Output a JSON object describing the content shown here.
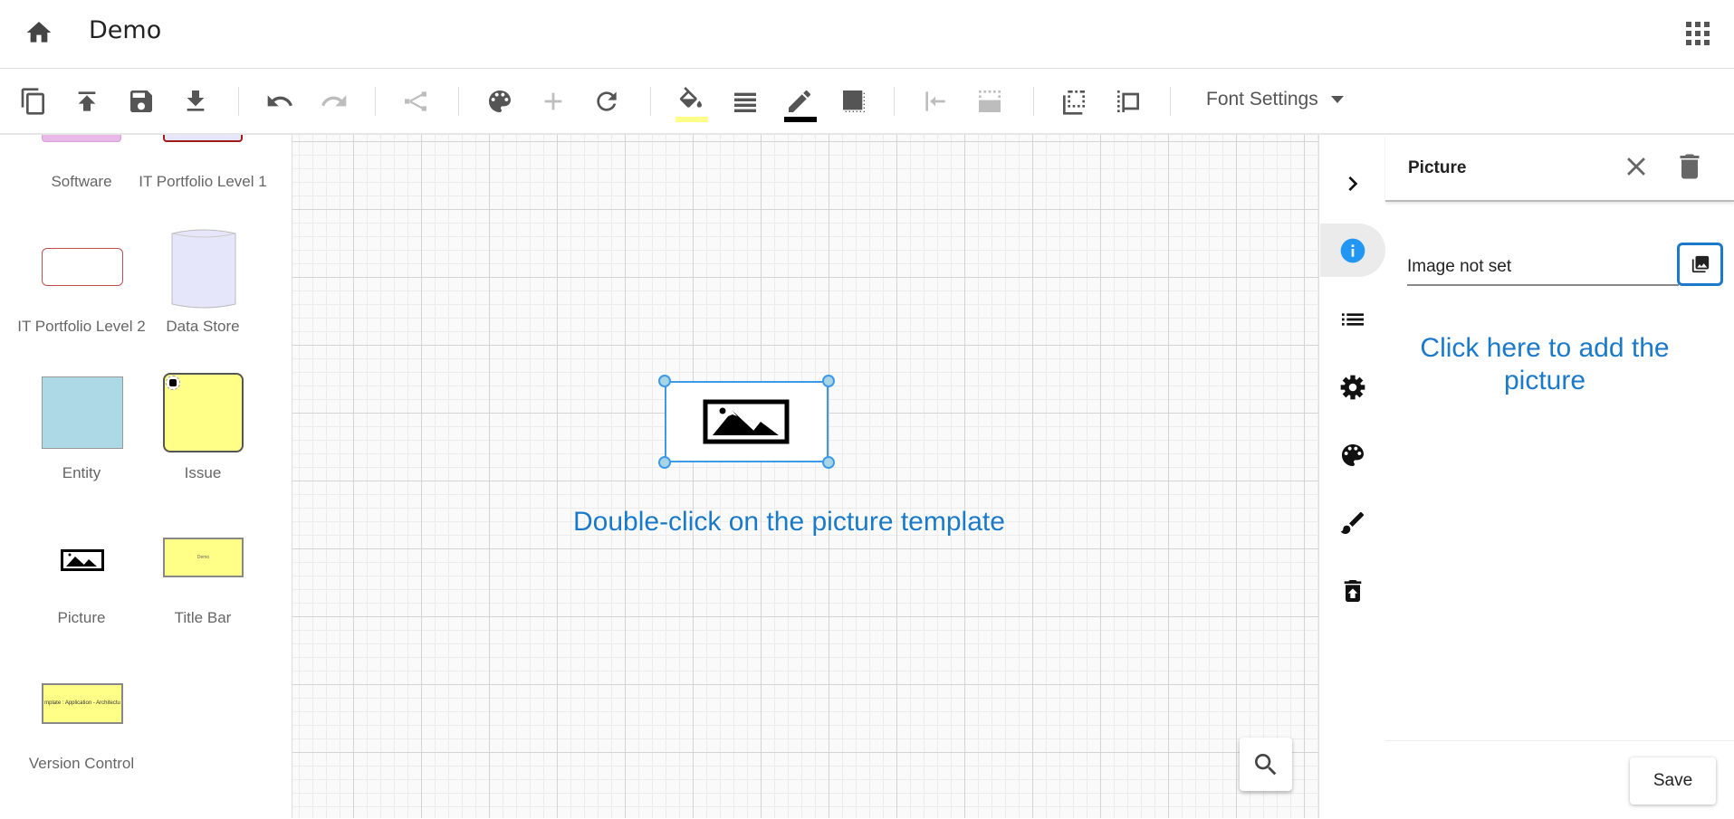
{
  "header": {
    "title": "Demo",
    "home_icon": "home-icon",
    "apps_icon": "apps-grid-icon"
  },
  "toolbar": {
    "items": [
      {
        "name": "copy",
        "icon": "copy",
        "enabled": true
      },
      {
        "name": "upload",
        "icon": "publish",
        "enabled": true
      },
      {
        "name": "save",
        "icon": "save",
        "enabled": true
      },
      {
        "name": "download",
        "icon": "download",
        "enabled": true
      },
      {
        "name": "undo",
        "icon": "undo",
        "enabled": true
      },
      {
        "name": "redo",
        "icon": "redo",
        "enabled": false
      },
      {
        "name": "connector",
        "icon": "connector",
        "enabled": false
      },
      {
        "name": "palette",
        "icon": "palette",
        "enabled": true
      },
      {
        "name": "add",
        "icon": "add",
        "enabled": false
      },
      {
        "name": "rotate",
        "icon": "rotate",
        "enabled": true
      },
      {
        "name": "fill-color",
        "icon": "fill",
        "enabled": true,
        "swatch": "#ffff88"
      },
      {
        "name": "line-style",
        "icon": "lines",
        "enabled": true
      },
      {
        "name": "line-color",
        "icon": "pencil",
        "enabled": true,
        "swatch": "#000000"
      },
      {
        "name": "shadow",
        "icon": "shadow",
        "enabled": true
      },
      {
        "name": "align-left",
        "icon": "align-left",
        "enabled": false
      },
      {
        "name": "background-image",
        "icon": "bg-image",
        "enabled": false
      },
      {
        "name": "send-back",
        "icon": "send-back",
        "enabled": true
      },
      {
        "name": "bring-front",
        "icon": "bring-front",
        "enabled": true
      }
    ],
    "font_settings_label": "Font Settings"
  },
  "shapes": [
    {
      "label": "Software"
    },
    {
      "label": "IT Portfolio Level 1"
    },
    {
      "label": "IT Portfolio Level 2"
    },
    {
      "label": "Data Store"
    },
    {
      "label": "Entity"
    },
    {
      "label": "Issue"
    },
    {
      "label": "Picture"
    },
    {
      "label": "Title Bar",
      "inner_text": "Demo"
    },
    {
      "label": "Version Control",
      "inner_text": "mplate : Application - Architectu"
    }
  ],
  "canvas": {
    "hint": "Double-click on the picture template",
    "selected_shape": "Picture"
  },
  "rail": [
    "chevron-right",
    "info",
    "list",
    "settings",
    "palette",
    "brush",
    "restore-from-trash"
  ],
  "panel": {
    "title": "Picture",
    "image_field_value": "Image not set",
    "hint": "Click here to add the picture",
    "save_label": "Save"
  },
  "colors": {
    "accent": "#1a7ac9",
    "info": "#2196f3",
    "selection": "#3d9ae8"
  }
}
